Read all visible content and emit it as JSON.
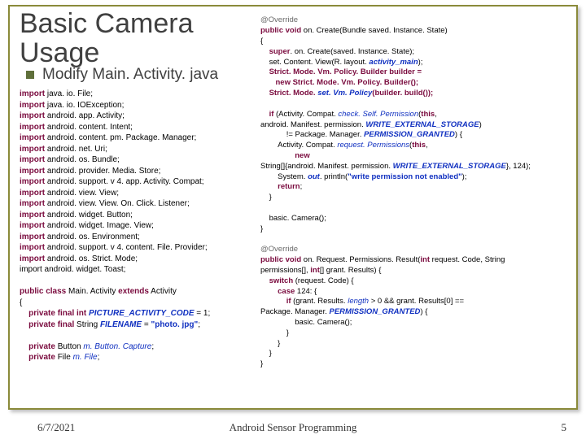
{
  "title_line1": "Basic Camera",
  "title_line2": "Usage",
  "subtitle": "Modify Main. Activity. java",
  "left_code": "<span class=\"kw\">import</span> java. io. File;\n<span class=\"kw\">import</span> java. io. IOException;\n<span class=\"kw\">import</span> android. app. Activity;\n<span class=\"kw\">import</span> android. content. Intent;\n<span class=\"kw\">import</span> android. content. pm. Package. Manager;\n<span class=\"kw\">import</span> android. net. Uri;\n<span class=\"kw\">import</span> android. os. Bundle;\n<span class=\"kw\">import</span> android. provider. Media. Store;\n<span class=\"kw\">import</span> android. support. v 4. app. Activity. Compat;\n<span class=\"kw\">import</span> android. view. View;\n<span class=\"kw\">import</span> android. view. View. On. Click. Listener;\n<span class=\"kw\">import</span> android. widget. Button;\n<span class=\"kw\">import</span> android. widget. Image. View;\n<span class=\"kw\">import</span> android. os. Environment;\n<span class=\"kw\">import</span> android. support. v 4. content. File. Provider;\n<span class=\"kw\">import</span> android. os. Strict. Mode;\nimport android. widget. Toast;\n\n<span class=\"kw\">public class</span> Main. Activity <span class=\"kw\">extends</span> Activity\n{\n    <span class=\"kw\">private final int</span> <span class=\"sfld\">PICTURE_ACTIVITY_CODE</span> = 1;\n    <span class=\"kw\">private final</span> String <span class=\"sfld\">FILENAME</span> = <span class=\"str\">\"photo. jpg\"</span>;\n\n    <span class=\"kw\">private</span> Button <span class=\"fld\">m. Button. Capture</span>;\n    <span class=\"kw\">private</span> File <span class=\"fld\">m. File</span>;",
  "right_code": "<span class=\"ann\">@Override</span>\n<span class=\"kw\">public void</span> on. Create(Bundle saved. Instance. State)\n{\n    <span class=\"kw\">super</span>. on. Create(saved. Instance. State);\n    set. Content. View(R. layout. <span class=\"sfld\">activity_main</span>);\n    <span class=\"kw\">Strict. Mode. Vm. Policy. Builder builder =\n       new Strict. Mode. Vm. Policy. Builder();\n    Strict. Mode. <span class=\"fld\">set. Vm. Policy</span>(builder. build());</span>\n\n    <span class=\"kw\">if</span> (Activity. Compat. <span class=\"fld\">check. Self. Permission</span>(<span class=\"kw\">this</span>,\nandroid. Manifest. permission. <span class=\"sfld\">WRITE_EXTERNAL_STORAGE</span>)\n            != Package. Manager. <span class=\"sfld\">PERMISSION_GRANTED</span>) {\n        Activity. Compat. <span class=\"fld\">request. Permissions</span>(<span class=\"kw\">this</span>,\n                <span class=\"kw\">new</span>\nString[]{android. Manifest. permission. <span class=\"sfld\">WRITE_EXTERNAL_STORAGE</span>}, 124);\n        System. <span class=\"sfld\">out</span>. println(<span class=\"str\">\"write permission not enabled\"</span>);\n        <span class=\"kw\">return</span>;\n    }\n\n    basic. Camera();\n}\n\n<span class=\"ann\">@Override</span>\n<span class=\"kw\">public void</span> on. Request. Permissions. Result(<span class=\"kw\">int</span> request. Code, String\npermissions[], <span class=\"kw\">int</span>[] grant. Results) {\n    <span class=\"kw\">switch</span> (request. Code) {\n        <span class=\"kw\">case</span> 124: {\n            <span class=\"kw\">if</span> (grant. Results. <span class=\"fld\">length</span> &gt; 0 &amp;&amp; grant. Results[0] ==\nPackage. Manager. <span class=\"sfld\">PERMISSION_GRANTED</span>) {\n                basic. Camera();\n            }\n        }\n    }\n}",
  "footer": {
    "date": "6/7/2021",
    "center": "Android Sensor Programming",
    "page": "5"
  }
}
